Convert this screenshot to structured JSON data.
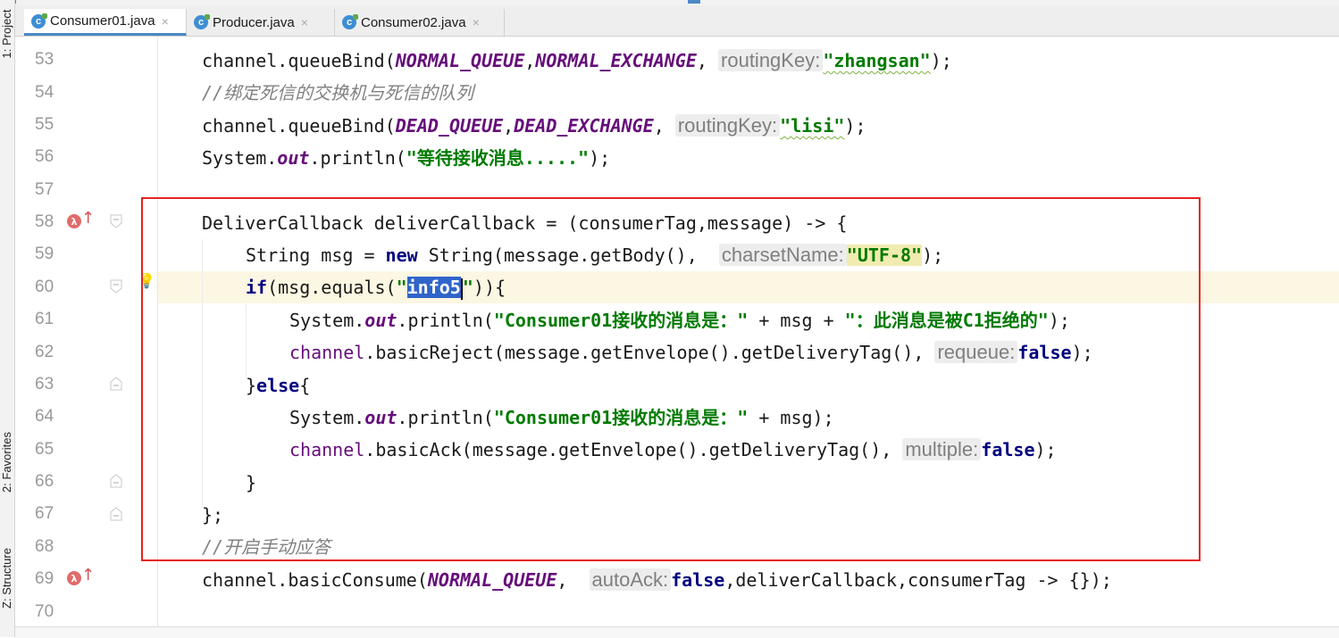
{
  "tabs": [
    {
      "label": "Consumer01.java",
      "active": true,
      "close": "×"
    },
    {
      "label": "Producer.java",
      "active": false,
      "close": "×"
    },
    {
      "label": "Consumer02.java",
      "active": false,
      "close": "×"
    }
  ],
  "toolwindows": {
    "project": "1: Project",
    "favorites": "2: Favorites",
    "structure": "Z: Structure"
  },
  "line_numbers": [
    "53",
    "54",
    "55",
    "56",
    "57",
    "58",
    "59",
    "60",
    "61",
    "62",
    "63",
    "64",
    "65",
    "66",
    "67",
    "68",
    "69",
    "70"
  ],
  "code": {
    "l53": {
      "a": "channel.queueBind(",
      "b": "NORMAL_QUEUE",
      "c": ",",
      "d": "NORMAL_EXCHANGE",
      "e": ", ",
      "hint": "routingKey:",
      "str": "\"zhangsan\"",
      "f": ");"
    },
    "l54": {
      "comment": "//绑定死信的交换机与死信的队列"
    },
    "l55": {
      "a": "channel.queueBind(",
      "b": "DEAD_QUEUE",
      "c": ",",
      "d": "DEAD_EXCHANGE",
      "e": ", ",
      "hint": "routingKey:",
      "str": "\"lisi\"",
      "f": ");"
    },
    "l56": {
      "a": "System.",
      "out": "out",
      "b": ".println(",
      "str": "\"等待接收消息.....\"",
      "f": ");"
    },
    "l58": {
      "a": "DeliverCallback deliverCallback = (consumerTag,message) -> {"
    },
    "l59": {
      "a": "String msg = ",
      "kw": "new",
      "b": " String(message.getBody(),  ",
      "hint": "charsetName:",
      "str": "\"UTF-8\"",
      "f": ");"
    },
    "l60": {
      "kw": "if",
      "a": "(msg.equals(",
      "q1": "\"",
      "sel": "info5",
      "q2": "\"",
      "f": ")){"
    },
    "l61": {
      "a": "System.",
      "out": "out",
      "b": ".println(",
      "s1": "\"Consumer01接收的消息是：\"",
      "c": " + msg + ",
      "s2": "\"：此消息是被C1拒绝的\"",
      "f": ");"
    },
    "l62": {
      "field": "channel",
      "a": ".basicReject(message.getEnvelope().getDeliveryTag(), ",
      "hint": "requeue:",
      "kw": "false",
      "f": ");"
    },
    "l63": {
      "a": "}",
      "kw": "else",
      "f": "{"
    },
    "l64": {
      "a": "System.",
      "out": "out",
      "b": ".println(",
      "s1": "\"Consumer01接收的消息是：\"",
      "f": " + msg);"
    },
    "l65": {
      "field": "channel",
      "a": ".basicAck(message.getEnvelope().getDeliveryTag(), ",
      "hint": "multiple:",
      "kw": "false",
      "f": ");"
    },
    "l66": {
      "a": "}"
    },
    "l67": {
      "a": "};"
    },
    "l68": {
      "comment": "//开启手动应答"
    },
    "l69": {
      "a": "channel.basicConsume(",
      "b": "NORMAL_QUEUE",
      "c": ",  ",
      "hint": "autoAck:",
      "kw": "false",
      "f": ",deliverCallback,consumerTag -> {});"
    }
  },
  "colors": {
    "annotation_box": "#e62222",
    "current_line": "#fcf7e3",
    "selection": "#2f65ca",
    "string": "#007a00",
    "keyword": "#000080"
  }
}
